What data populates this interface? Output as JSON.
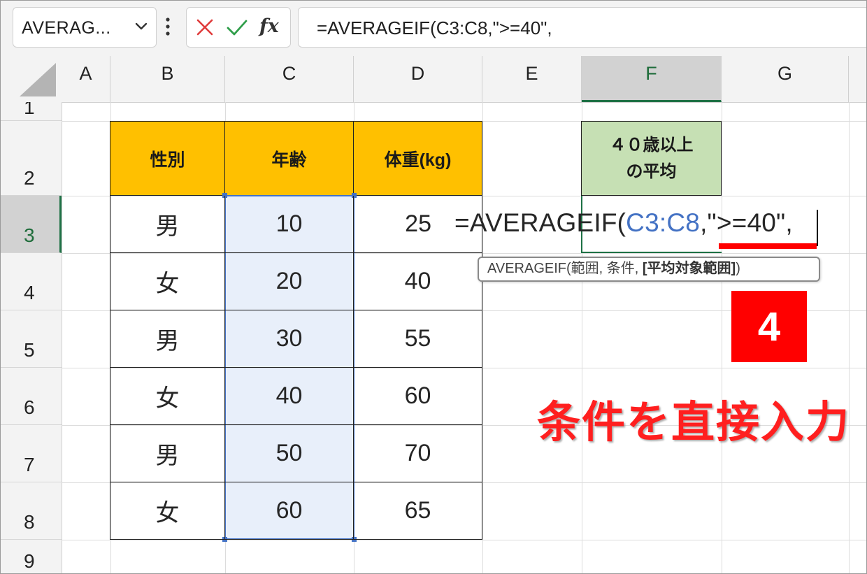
{
  "formula_bar": {
    "name_box": "AVERAG...",
    "name_box_icon": "chevron-down-icon",
    "more_icon": "vertical-ellipsis-icon",
    "cancel_icon": "cross-icon",
    "enter_icon": "checkmark-icon",
    "function_icon": "fx",
    "formula": "=AVERAGEIF(C3:C8,\">=40\","
  },
  "grid": {
    "columns": [
      "A",
      "B",
      "C",
      "D",
      "E",
      "F",
      "G"
    ],
    "selected_column": "F",
    "rows": [
      "1",
      "2",
      "3",
      "4",
      "5",
      "6",
      "7",
      "8",
      "9"
    ],
    "selected_row": "3"
  },
  "table": {
    "headers": [
      "性別",
      "年齢",
      "体重(kg)"
    ],
    "rows": [
      {
        "gender": "男",
        "age": "10",
        "weight": "25"
      },
      {
        "gender": "女",
        "age": "20",
        "weight": "40"
      },
      {
        "gender": "男",
        "age": "30",
        "weight": "55"
      },
      {
        "gender": "女",
        "age": "40",
        "weight": "60"
      },
      {
        "gender": "男",
        "age": "50",
        "weight": "70"
      },
      {
        "gender": "女",
        "age": "60",
        "weight": "65"
      }
    ]
  },
  "result_header": {
    "line1": "４０歳以上",
    "line2": "の平均"
  },
  "in_cell_formula": {
    "prefix": "=AVERAGEIF(",
    "range_ref": "C3:C8",
    "criteria": ",\">=40\","
  },
  "tooltip": {
    "function": "AVERAGEIF(",
    "args": "範囲, 条件, ",
    "optional": "[平均対象範囲]",
    "close": ")"
  },
  "annotation": {
    "step_number": "4",
    "text": "条件を直接入力"
  },
  "colors": {
    "header_orange": "#ffc000",
    "result_green": "#c6e0b4",
    "range_blue": "#4472c4",
    "annotation_red": "#ff0000",
    "selected_header_green": "#1e7145"
  }
}
